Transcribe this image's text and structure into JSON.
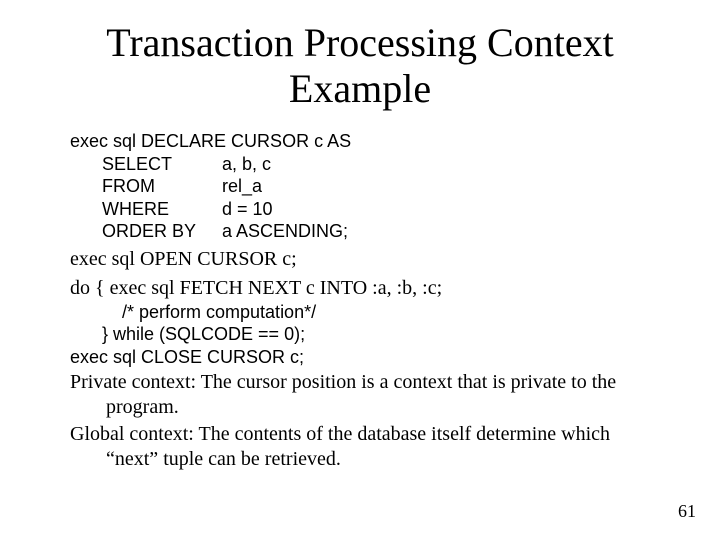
{
  "title": "Transaction Processing Context Example",
  "declare": {
    "head": "exec sql DECLARE CURSOR c AS",
    "rows": [
      {
        "kw": "SELECT",
        "arg": "a, b, c"
      },
      {
        "kw": "FROM",
        "arg": "rel_a"
      },
      {
        "kw": "WHERE",
        "arg": "d = 10"
      },
      {
        "kw": "ORDER BY",
        "arg": "a ASCENDING;"
      }
    ]
  },
  "open_line": "exec sql OPEN CURSOR c;",
  "fetch_line": "do { exec sql FETCH NEXT c INTO :a, :b, :c;",
  "loop": {
    "comment": "/* perform computation*/",
    "while": "} while (SQLCODE == 0);",
    "close": "exec sql CLOSE CURSOR c;"
  },
  "private_context": "Private context: The cursor position is a context that is private to the program.",
  "global_context": "Global context: The contents of the database itself determine which “next” tuple can be retrieved.",
  "page_number": "61"
}
